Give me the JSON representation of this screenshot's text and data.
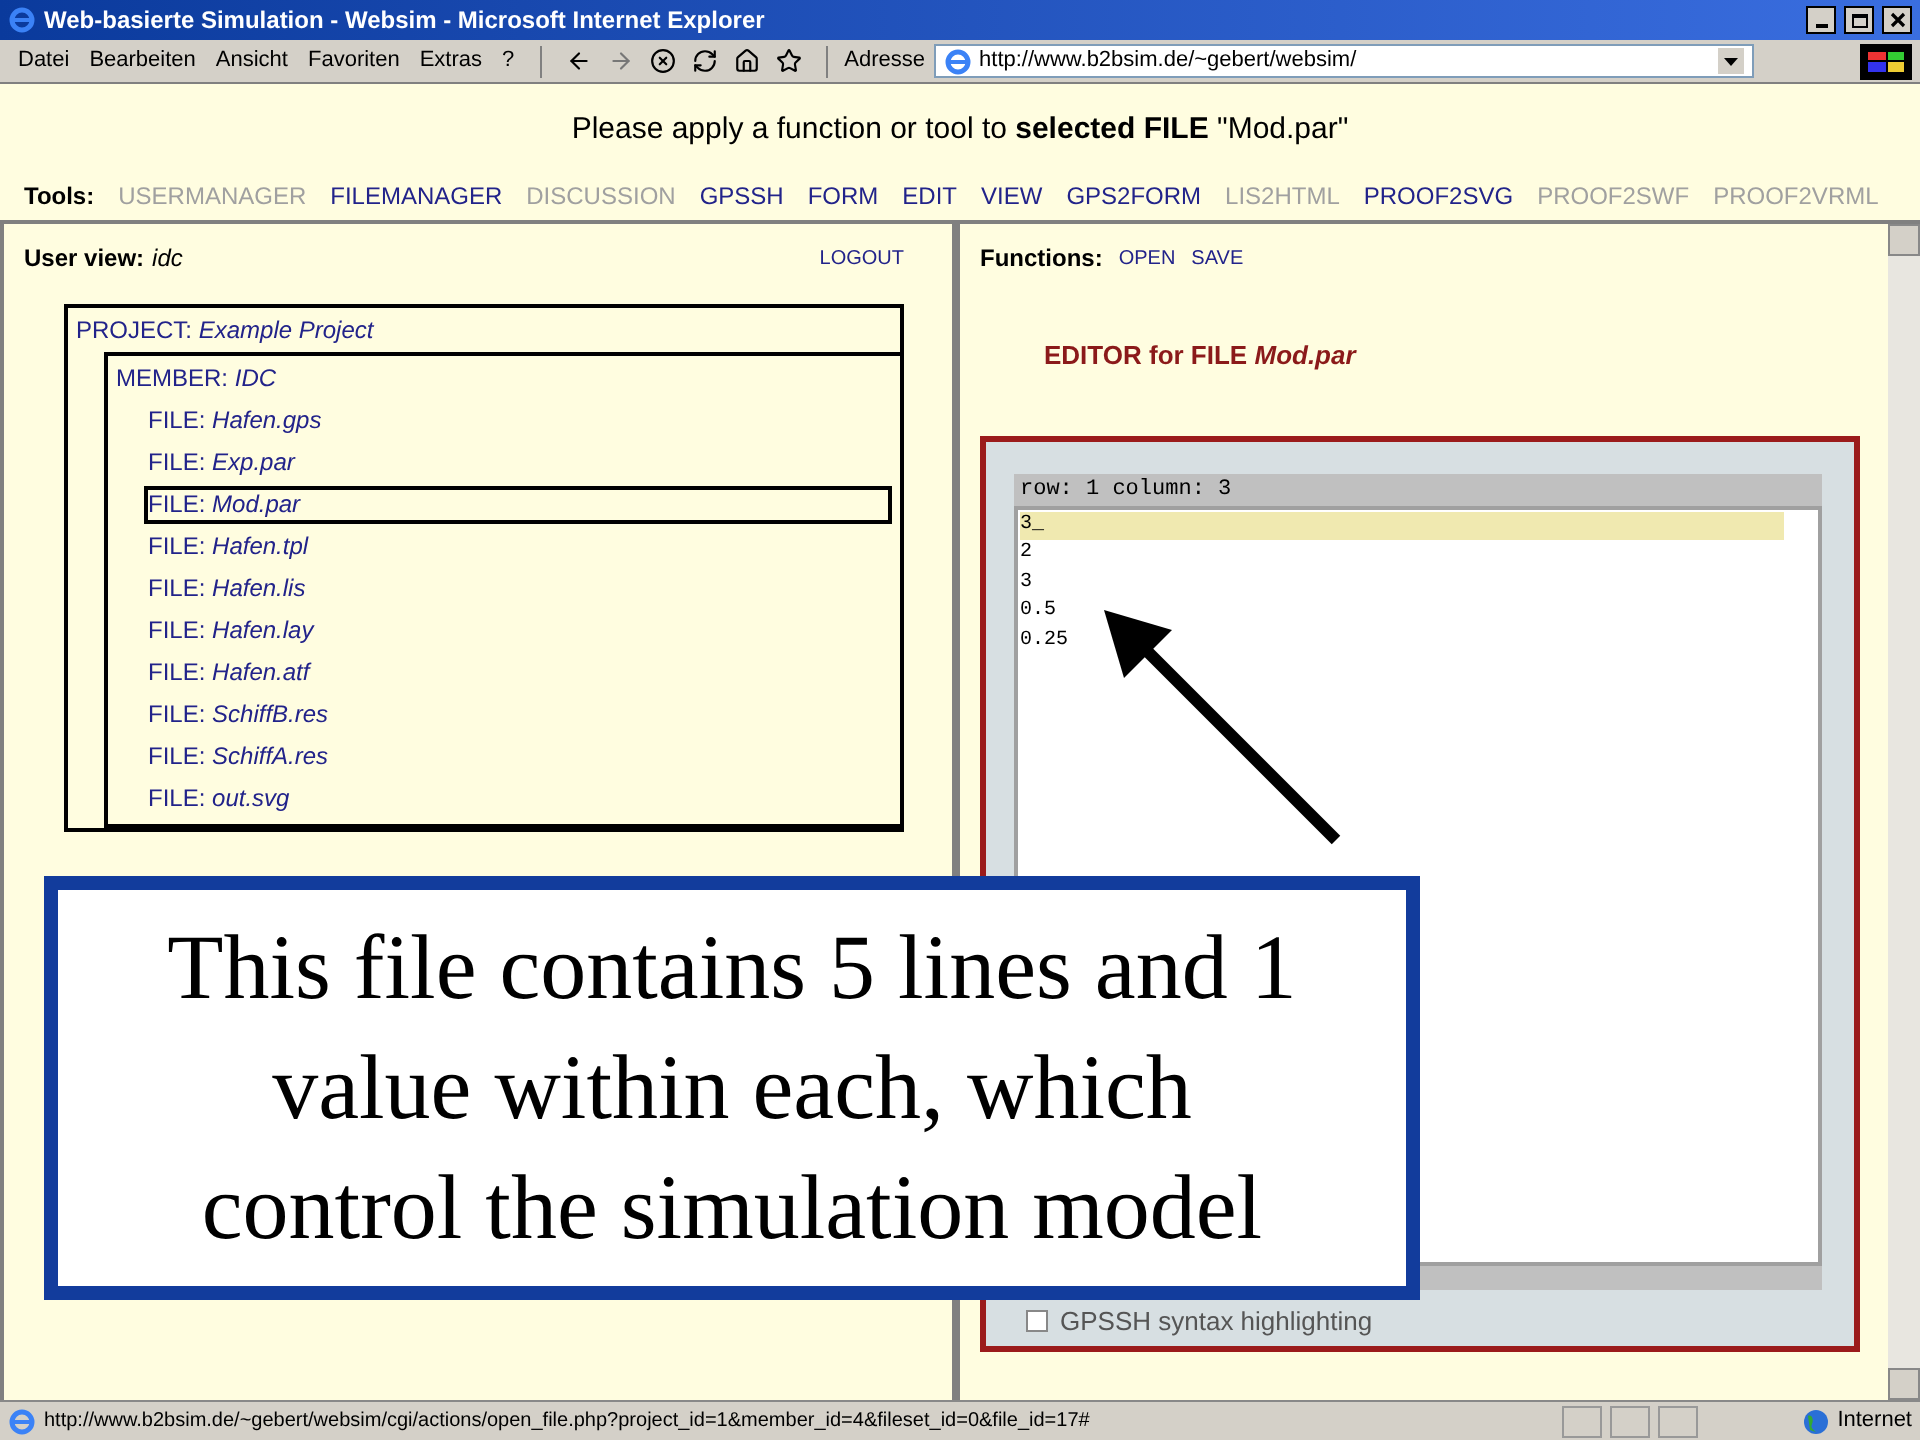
{
  "window": {
    "title": "Web-basierte Simulation - Websim - Microsoft Internet Explorer"
  },
  "menu": [
    "Datei",
    "Bearbeiten",
    "Ansicht",
    "Favoriten",
    "Extras",
    "?"
  ],
  "address": {
    "label": "Adresse",
    "value": "http://www.b2bsim.de/~gebert/websim/"
  },
  "header": {
    "message": "Please apply a function or tool to **selected FILE** \"Mod.par\""
  },
  "tools": {
    "label": "Tools:",
    "items": [
      {
        "label": "USERMANAGER",
        "enabled": false
      },
      {
        "label": "FILEMANAGER",
        "enabled": true
      },
      {
        "label": "DISCUSSION",
        "enabled": false
      },
      {
        "label": "GPSSH",
        "enabled": true
      },
      {
        "label": "FORM",
        "enabled": true
      },
      {
        "label": "EDIT",
        "enabled": true
      },
      {
        "label": "VIEW",
        "enabled": true
      },
      {
        "label": "GPS2FORM",
        "enabled": true
      },
      {
        "label": "LIS2HTML",
        "enabled": false
      },
      {
        "label": "PROOF2SVG",
        "enabled": true
      },
      {
        "label": "PROOF2SWF",
        "enabled": false
      },
      {
        "label": "PROOF2VRML",
        "enabled": false
      }
    ]
  },
  "user_view": {
    "label": "User view:",
    "value": "idc",
    "logout": "LOGOUT"
  },
  "tree": {
    "label": "PROJECT:",
    "name": "Example Project",
    "children": [
      {
        "label": "MEMBER:",
        "name": "IDC",
        "children": [
          {
            "label": "FILE:",
            "name": "Hafen.gps",
            "selected": false
          },
          {
            "label": "FILE:",
            "name": "Exp.par",
            "selected": false
          },
          {
            "label": "FILE:",
            "name": "Mod.par",
            "selected": true
          },
          {
            "label": "FILE:",
            "name": "Hafen.tpl",
            "selected": false
          },
          {
            "label": "FILE:",
            "name": "Hafen.lis",
            "selected": false
          },
          {
            "label": "FILE:",
            "name": "Hafen.lay",
            "selected": false
          },
          {
            "label": "FILE:",
            "name": "Hafen.atf",
            "selected": false
          },
          {
            "label": "FILE:",
            "name": "SchiffB.res",
            "selected": false
          },
          {
            "label": "FILE:",
            "name": "SchiffA.res",
            "selected": false
          },
          {
            "label": "FILE:",
            "name": "out.svg",
            "selected": false
          }
        ]
      }
    ]
  },
  "functions": {
    "label": "Functions:",
    "items": [
      "OPEN",
      "SAVE"
    ]
  },
  "editor": {
    "title": "EDITOR for FILE",
    "file": "Mod.par",
    "status": "row: 1 column: 3",
    "lines": [
      {
        "text": "3_",
        "current": true
      },
      {
        "text": "2",
        "current": false
      },
      {
        "text": "3",
        "current": false
      },
      {
        "text": "0.5",
        "current": false
      },
      {
        "text": "0.25",
        "current": false
      }
    ],
    "option": {
      "label": "GPSSH syntax highlighting",
      "checked": false
    }
  },
  "callout": {
    "text": "This file contains 5 lines and 1 value within each, which control the simulation model"
  },
  "status_bar": {
    "url": "http://www.b2bsim.de/~gebert/websim/cgi/actions/open_file.php?project_id=1&member_id=4&fileset_id=0&file_id=17#",
    "zone": "Internet"
  }
}
